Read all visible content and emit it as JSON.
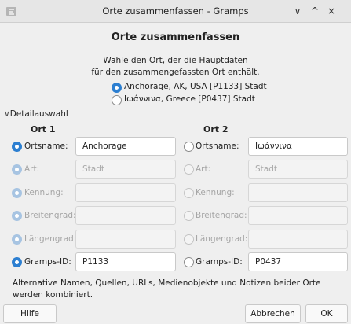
{
  "window": {
    "title": "Orte zusammenfassen - Gramps",
    "minimize_icon": "chevron-down-icon",
    "maximize_icon": "chevron-up-icon",
    "close_icon": "close-icon",
    "minimize_glyph": "∨",
    "maximize_glyph": "^",
    "close_glyph": "×"
  },
  "dialog": {
    "heading": "Orte zusammenfassen",
    "intro_line1": "Wähle den Ort, der die Hauptdaten",
    "intro_line2": "für den zusammengefassten Ort enthält.",
    "choices": [
      {
        "label": "Anchorage, AK, USA [P1133] Stadt",
        "selected": true
      },
      {
        "label": "Ιωάννινα, Greece [P0437] Stadt",
        "selected": false
      }
    ],
    "expander_label": "Detailauswahl",
    "col1_heading": "Ort 1",
    "col2_heading": "Ort 2",
    "rows": [
      {
        "label": "Ortsname:",
        "left_value": "Anchorage",
        "right_value": "Ιωάννινα",
        "enabled": true
      },
      {
        "label": "Art:",
        "left_value": "Stadt",
        "right_value": "Stadt",
        "enabled": false
      },
      {
        "label": "Kennung:",
        "left_value": "",
        "right_value": "",
        "enabled": false
      },
      {
        "label": "Breitengrad:",
        "left_value": "",
        "right_value": "",
        "enabled": false
      },
      {
        "label": "Längengrad:",
        "left_value": "",
        "right_value": "",
        "enabled": false
      },
      {
        "label": "Gramps-ID:",
        "left_value": "P1133",
        "right_value": "P0437",
        "enabled": true
      }
    ],
    "note": "Alternative Namen, Quellen, URLs, Medienobjekte und Notizen beider Orte werden kombiniert."
  },
  "buttons": {
    "help": "Hilfe",
    "cancel": "Abbrechen",
    "ok": "OK"
  },
  "colors": {
    "accent": "#2c7fd1"
  }
}
